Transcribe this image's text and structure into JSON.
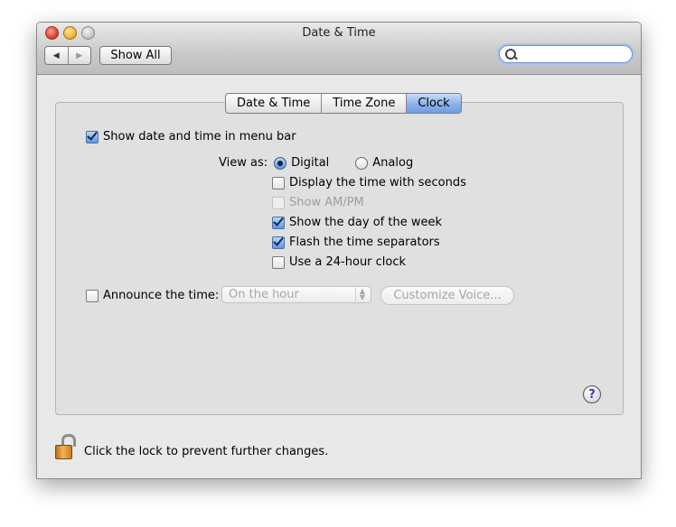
{
  "window": {
    "title": "Date & Time"
  },
  "toolbar": {
    "back_glyph": "◀",
    "forward_glyph": "▶",
    "show_all_label": "Show All",
    "search_placeholder": ""
  },
  "tabs": [
    {
      "label": "Date & Time",
      "active": false
    },
    {
      "label": "Time Zone",
      "active": false
    },
    {
      "label": "Clock",
      "active": true
    }
  ],
  "clock": {
    "show_in_menu_bar": {
      "label": "Show date and time in menu bar",
      "checked": true
    },
    "view_as_label": "View as:",
    "view_options": [
      {
        "label": "Digital",
        "selected": true
      },
      {
        "label": "Analog",
        "selected": false
      }
    ],
    "options": [
      {
        "label": "Display the time with seconds",
        "checked": false,
        "disabled": false
      },
      {
        "label": "Show AM/PM",
        "checked": false,
        "disabled": true
      },
      {
        "label": "Show the day of the week",
        "checked": true,
        "disabled": false
      },
      {
        "label": "Flash the time separators",
        "checked": true,
        "disabled": false
      },
      {
        "label": "Use a 24-hour clock",
        "checked": false,
        "disabled": false
      }
    ],
    "announce": {
      "label": "Announce the time:",
      "checked": false,
      "interval_value": "On the hour",
      "customize_label": "Customize Voice..."
    }
  },
  "help_glyph": "?",
  "lock_message": "Click the lock to prevent further changes.",
  "colors": {
    "accent_selected_tab": "#8ab2e8",
    "checkbox_checked": "#5f95e0",
    "window_bg": "#e8e8e8"
  }
}
